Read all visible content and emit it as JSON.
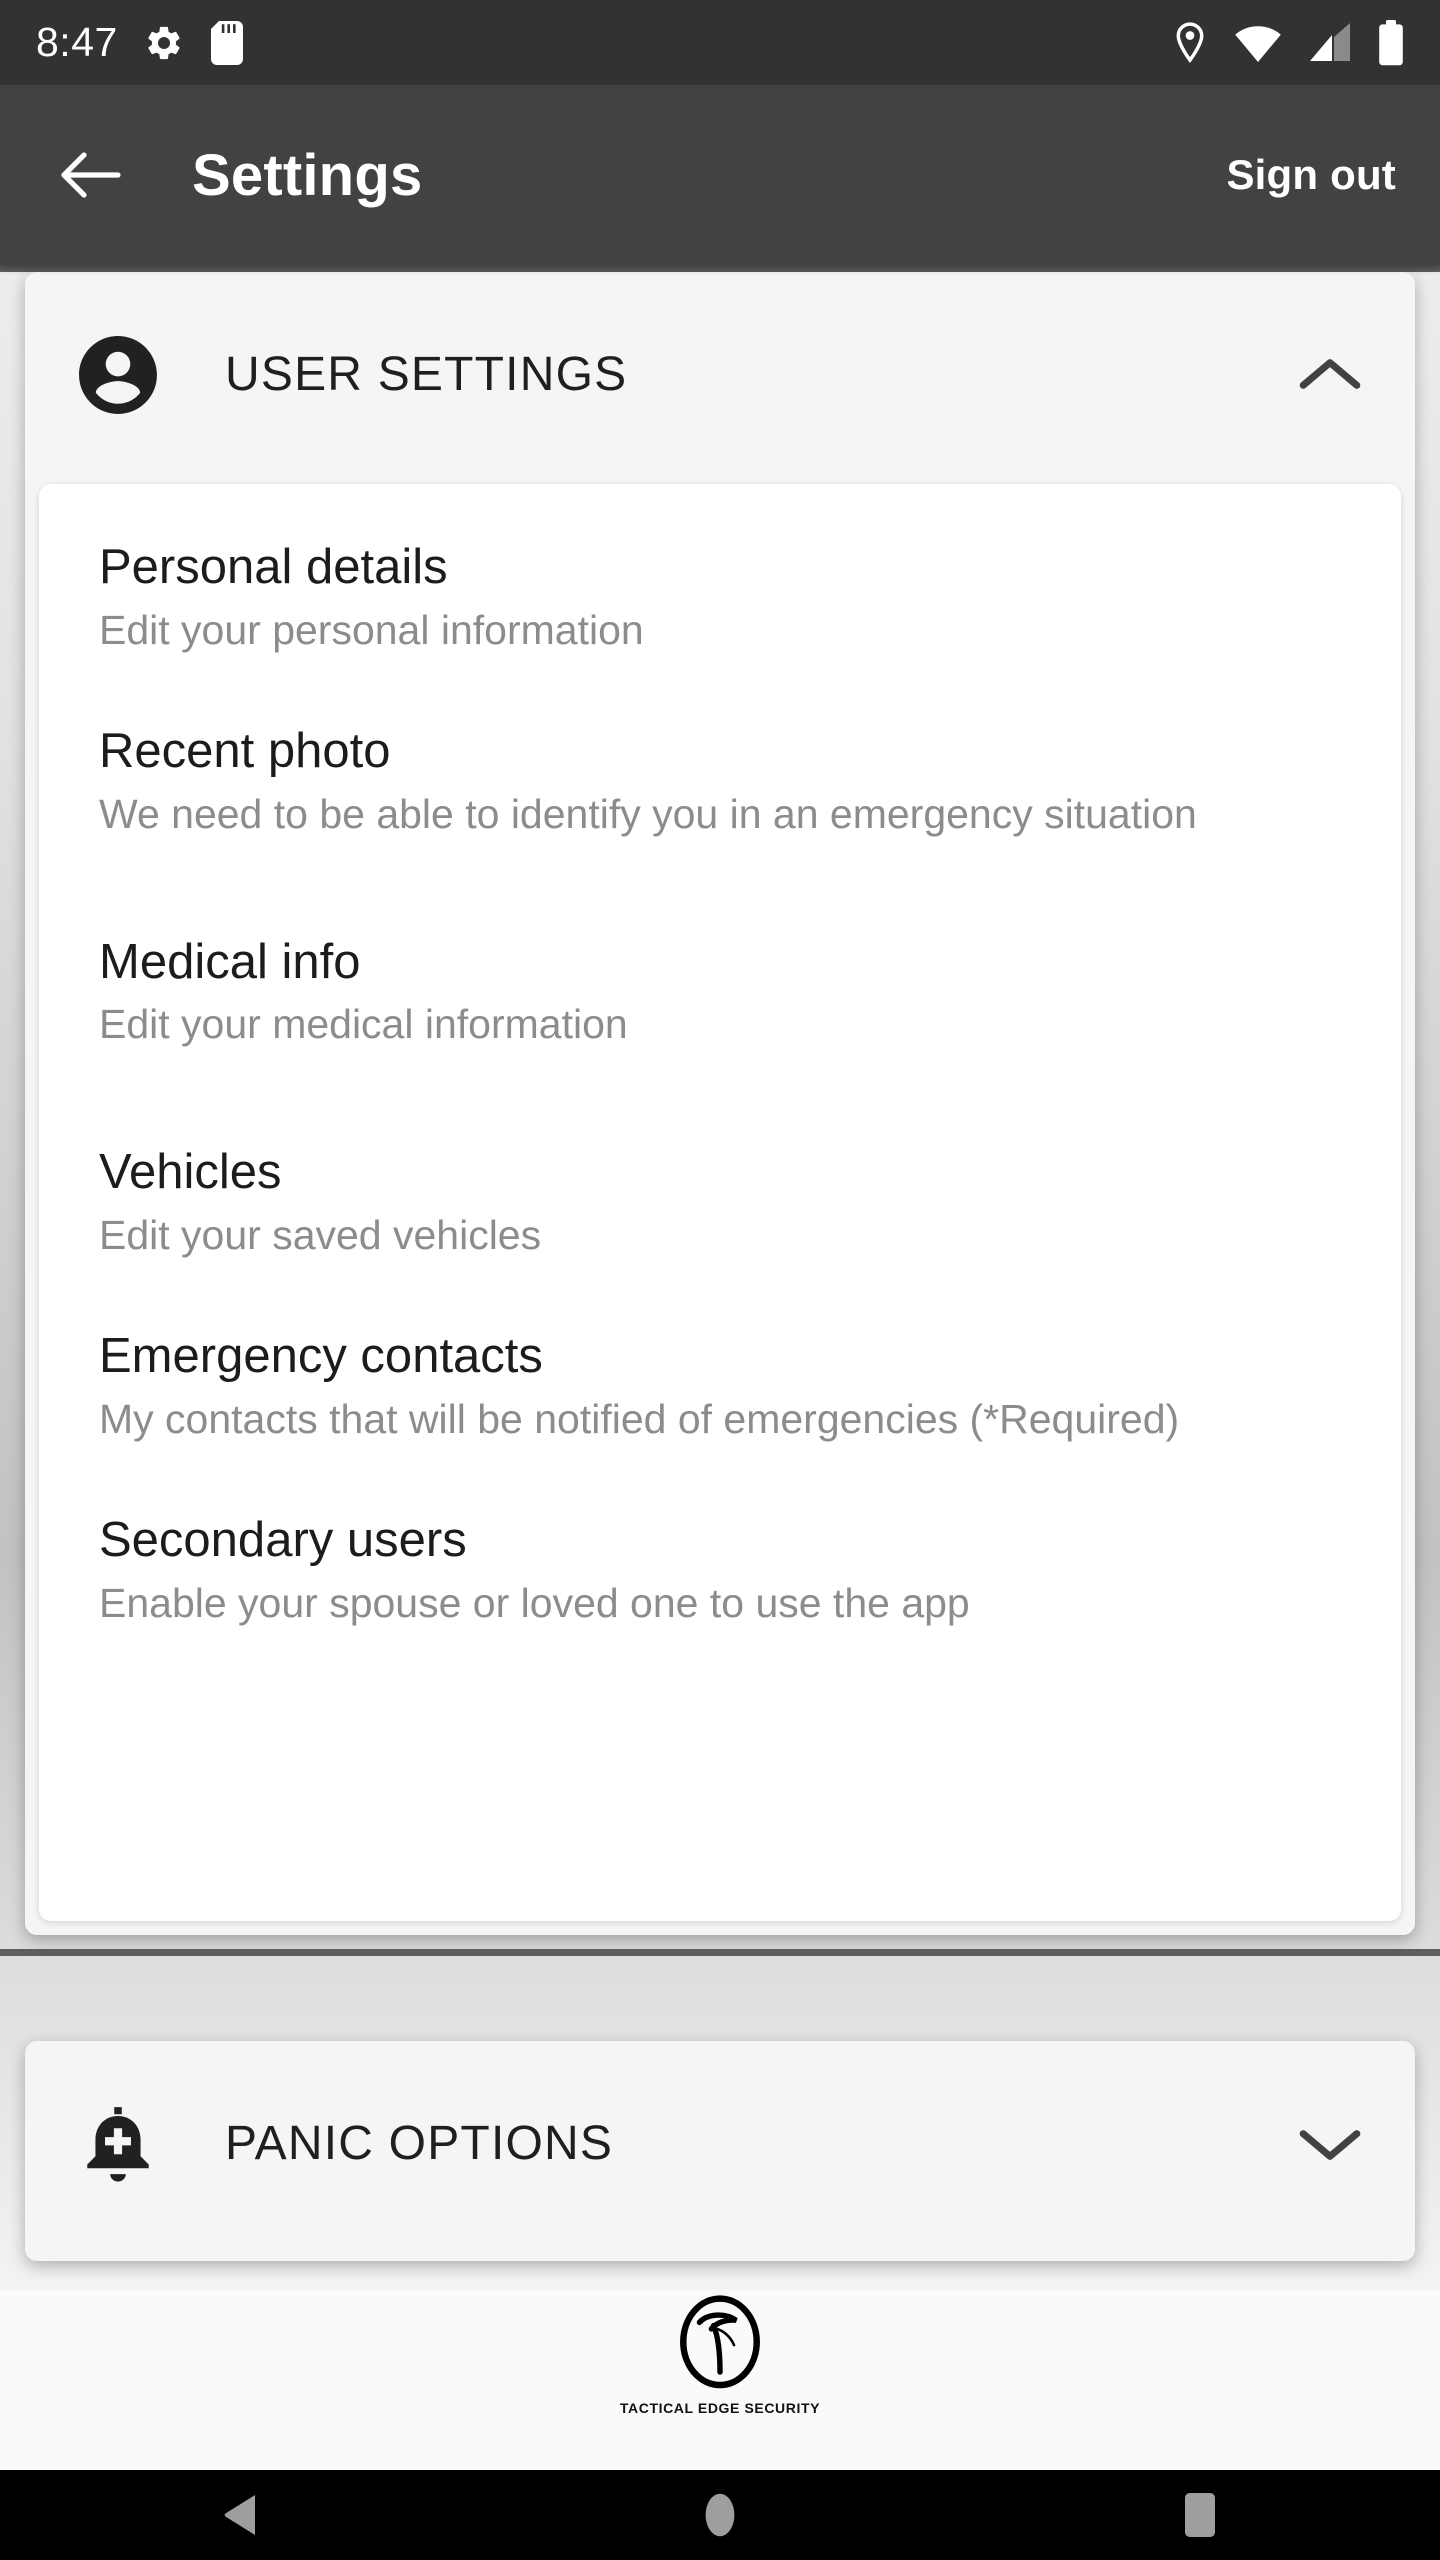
{
  "status_bar": {
    "time": "8:47",
    "left_icons": [
      "gear-icon",
      "sd-card-icon"
    ],
    "right_icons": [
      "location-pin-icon",
      "wifi-icon",
      "cellular-signal-icon",
      "battery-icon"
    ],
    "background_color": "#323232",
    "foreground_color": "#ffffff"
  },
  "app_bar": {
    "back_label": "back-arrow",
    "title": "Settings",
    "action_label": "Sign out",
    "background_color": "#424242"
  },
  "sections": [
    {
      "id": "user-settings",
      "icon": "account-circle-icon",
      "title": "USER SETTINGS",
      "expanded": true,
      "chevron": "chevron-up-icon",
      "items": [
        {
          "title": "Personal details",
          "subtitle": "Edit your personal information"
        },
        {
          "title": "Recent photo",
          "subtitle": "We need to be able to identify you in an emergency situation"
        },
        {
          "title": "Medical info",
          "subtitle": "Edit your medical information"
        },
        {
          "title": "Vehicles",
          "subtitle": "Edit your saved vehicles"
        },
        {
          "title": "Emergency contacts",
          "subtitle": "My contacts that will be notified of emergencies (*Required)"
        },
        {
          "title": "Secondary users",
          "subtitle": "Enable your spouse or loved one to use the app"
        }
      ]
    },
    {
      "id": "panic-options",
      "icon": "add-alert-bell-icon",
      "title": "PANIC OPTIONS",
      "expanded": false,
      "chevron": "chevron-down-icon",
      "items": []
    }
  ],
  "footer": {
    "logo_mark": "tactical-edge-circle-logo",
    "logo_text": "TACTICAL EDGE SECURITY"
  },
  "nav_bar": {
    "buttons": [
      "back-triangle-icon",
      "home-circle-icon",
      "recents-square-icon"
    ],
    "background_color": "#000000",
    "icon_color": "#9e9e9e"
  },
  "colors": {
    "app_bar": "#424242",
    "status_bar": "#323232",
    "card_header": "#f5f5f5",
    "card_body": "#ffffff",
    "title_text": "#1c1c1c",
    "subtitle_text": "#8c8c8c",
    "scroll_rule": "#5e5e5e"
  }
}
